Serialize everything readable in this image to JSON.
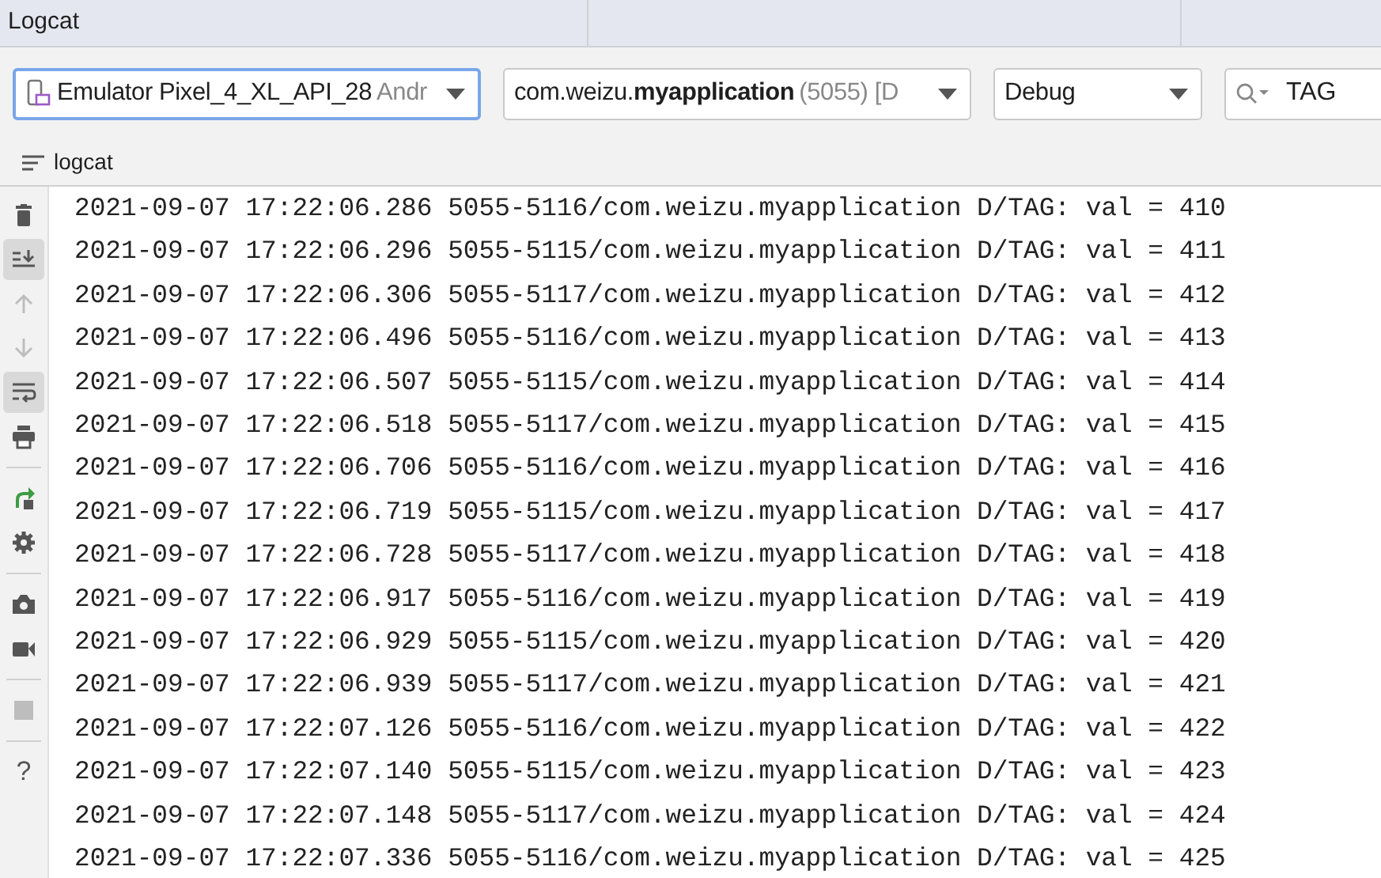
{
  "window": {
    "title": "Logcat"
  },
  "filters": [
    {
      "kind": "device",
      "text": "Emulator Pixel_4_XL_API_28",
      "detail": "Andr",
      "focused": true
    },
    {
      "kind": "process",
      "text": "com.weizu.**myapplication**",
      "detail": "(5055) [D",
      "focused": false
    },
    {
      "kind": "level",
      "text": "Debug",
      "focused": false
    }
  ],
  "search": {
    "value": "TAG"
  },
  "tab": {
    "label": "logcat"
  },
  "toolbar": [
    {
      "kind": "trash",
      "selected": false,
      "disabled": false
    },
    {
      "kind": "scroll-end",
      "selected": true,
      "disabled": false
    },
    {
      "kind": "up",
      "selected": false,
      "disabled": true
    },
    {
      "kind": "down",
      "selected": false,
      "disabled": true
    },
    {
      "kind": "wrap",
      "selected": true,
      "disabled": false
    },
    {
      "kind": "print",
      "selected": false,
      "disabled": false
    },
    {
      "kind": "sep"
    },
    {
      "kind": "restart",
      "selected": false,
      "disabled": false
    },
    {
      "kind": "gear",
      "selected": false,
      "disabled": false
    },
    {
      "kind": "sep"
    },
    {
      "kind": "camera",
      "selected": false,
      "disabled": false
    },
    {
      "kind": "video",
      "selected": false,
      "disabled": false
    },
    {
      "kind": "sep"
    },
    {
      "kind": "stop",
      "selected": false,
      "disabled": true
    },
    {
      "kind": "sep"
    },
    {
      "kind": "help",
      "text": "?",
      "selected": false,
      "disabled": false
    }
  ],
  "log": [
    "2021-09-07 17:22:06.286 5055-5116/com.weizu.myapplication D/TAG: val = 410",
    "2021-09-07 17:22:06.296 5055-5115/com.weizu.myapplication D/TAG: val = 411",
    "2021-09-07 17:22:06.306 5055-5117/com.weizu.myapplication D/TAG: val = 412",
    "2021-09-07 17:22:06.496 5055-5116/com.weizu.myapplication D/TAG: val = 413",
    "2021-09-07 17:22:06.507 5055-5115/com.weizu.myapplication D/TAG: val = 414",
    "2021-09-07 17:22:06.518 5055-5117/com.weizu.myapplication D/TAG: val = 415",
    "2021-09-07 17:22:06.706 5055-5116/com.weizu.myapplication D/TAG: val = 416",
    "2021-09-07 17:22:06.719 5055-5115/com.weizu.myapplication D/TAG: val = 417",
    "2021-09-07 17:22:06.728 5055-5117/com.weizu.myapplication D/TAG: val = 418",
    "2021-09-07 17:22:06.917 5055-5116/com.weizu.myapplication D/TAG: val = 419",
    "2021-09-07 17:22:06.929 5055-5115/com.weizu.myapplication D/TAG: val = 420",
    "2021-09-07 17:22:06.939 5055-5117/com.weizu.myapplication D/TAG: val = 421",
    "2021-09-07 17:22:07.126 5055-5116/com.weizu.myapplication D/TAG: val = 422",
    "2021-09-07 17:22:07.140 5055-5115/com.weizu.myapplication D/TAG: val = 423",
    "2021-09-07 17:22:07.148 5055-5117/com.weizu.myapplication D/TAG: val = 424",
    "2021-09-07 17:22:07.336 5055-5116/com.weizu.myapplication D/TAG: val = 425"
  ]
}
